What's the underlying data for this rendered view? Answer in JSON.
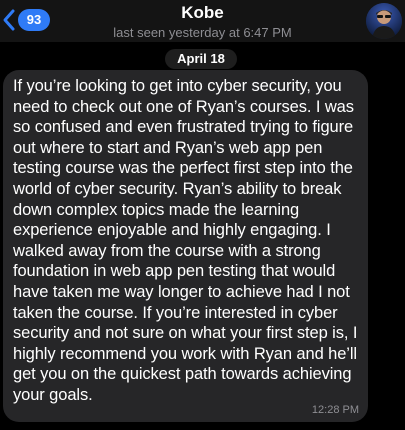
{
  "header": {
    "back_count": "93",
    "contact_name": "Kobe",
    "last_seen": "last seen yesterday at 6:47 PM",
    "back_icon": "chevron-left-icon",
    "accent_color": "#2f7bf6"
  },
  "chat": {
    "date_label": "April 18",
    "message": {
      "text": "If you’re looking to get into cyber security, you need to check out one of Ryan’s courses. I was so confused and even frustrated trying to figure out where to start and Ryan’s web app pen testing course was the perfect first step into the world of cyber security. Ryan’s ability to break down complex topics made the learning experience enjoyable and highly engaging. I walked away from the course with a strong foundation in web app pen testing that would have taken me way longer to achieve had I not taken the course. If you’re interested in cyber security and not sure on what your first step is, I highly recommend you work with Ryan and he’ll get you on the quickest path towards achieving your goals.",
      "time": "12:28 PM"
    }
  }
}
